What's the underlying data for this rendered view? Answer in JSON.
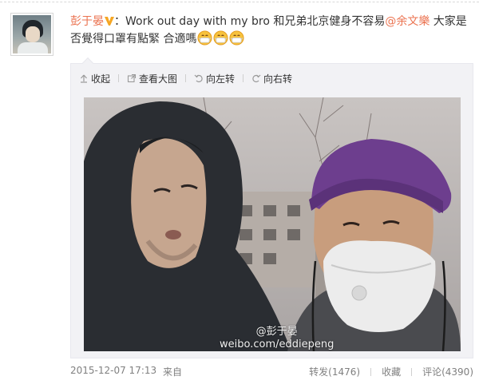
{
  "post": {
    "username": "彭于晏",
    "colon": "：",
    "text_before_mention": "Work out day with my bro 和兄弟北京健身不容易",
    "mention": "@余文樂",
    "text_after_mention": " 大家是否覺得口罩有點緊 合適嗎",
    "emoji_icon": "mask-face-emoji",
    "emoji_count": 3
  },
  "toolbar": {
    "collapse_label": "收起",
    "view_large_label": "查看大图",
    "rotate_left_label": "向左转",
    "rotate_right_label": "向右转"
  },
  "photo": {
    "watermark_line1": "@彭于晏",
    "watermark_line2": "weibo.com/eddiepeng"
  },
  "footer": {
    "timestamp": "2015-12-07 17:13",
    "from_label": "来自",
    "repost_label": "转发(1476)",
    "favorite_label": "收藏",
    "comment_label": "评论(4390)"
  },
  "colors": {
    "link": "#eb7350",
    "text": "#333333",
    "meta": "#808080",
    "media_bg": "#f2f2f5",
    "vip_badge": "#f5a623"
  }
}
